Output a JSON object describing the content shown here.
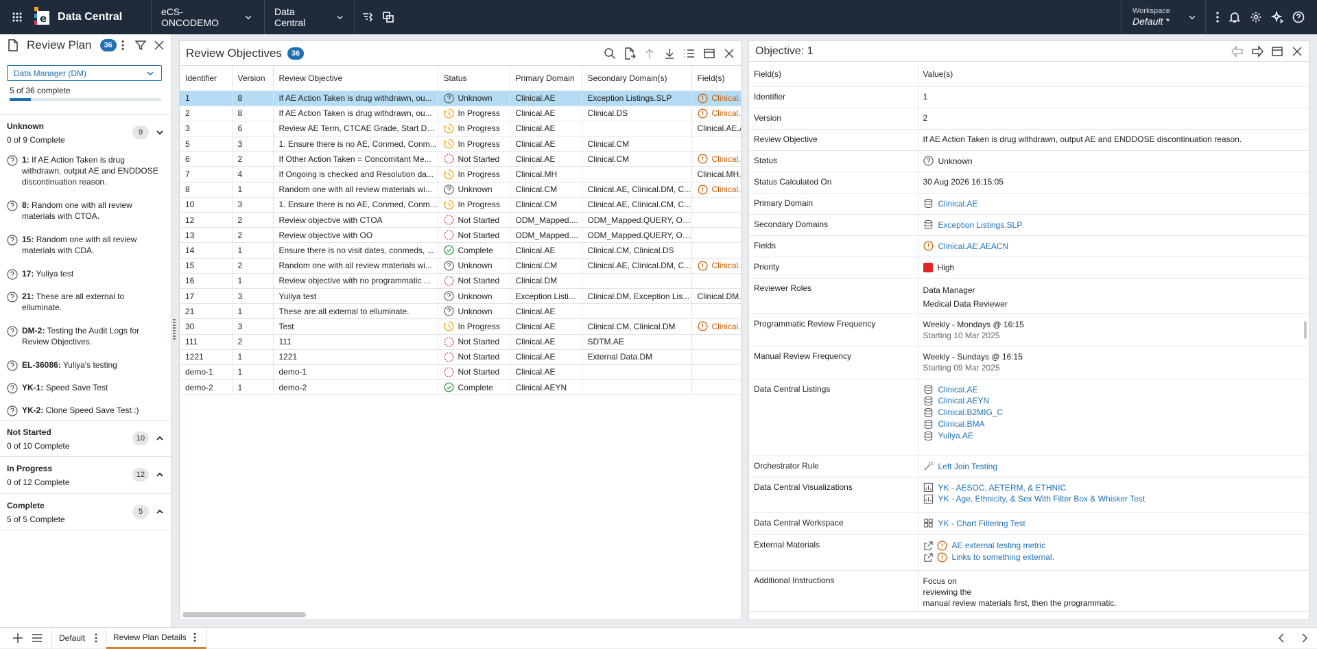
{
  "header": {
    "app_name": "Data Central",
    "study": "eCS-ONCODEMO",
    "module": "Data Central",
    "workspace_label": "Workspace",
    "workspace_value": "Default",
    "workspace_mark": "*"
  },
  "left": {
    "title": "Review Plan",
    "count": "36",
    "role": "Data Manager (DM)",
    "progress_text": "5 of 36 complete",
    "progress_fraction": 0.139,
    "groups": [
      {
        "title": "Unknown",
        "sub": "0 of 9 Complete",
        "count": "9"
      },
      {
        "title": "Not Started",
        "sub": "0 of 10 Complete",
        "count": "10"
      },
      {
        "title": "In Progress",
        "sub": "0 of 12 Complete",
        "count": "12"
      },
      {
        "title": "Complete",
        "sub": "5 of 5 Complete",
        "count": "5"
      }
    ],
    "items": [
      {
        "id": "1:",
        "text": "If AE Action Taken is drug withdrawn, output AE and ENDDOSE discontinuation reason."
      },
      {
        "id": "8:",
        "text": "Random one with all review materials with CTOA."
      },
      {
        "id": "15:",
        "text": "Random one with all review materials with CDA."
      },
      {
        "id": "17:",
        "text": "Yuliya test"
      },
      {
        "id": "21:",
        "text": "These are all external to elluminate."
      },
      {
        "id": "DM-2:",
        "text": "Testing the Audit Logs for Review Objectives."
      },
      {
        "id": "EL-36086:",
        "text": "Yuliya's testing"
      },
      {
        "id": "YK-1:",
        "text": "Speed Save Test"
      },
      {
        "id": "YK-2:",
        "text": "Clone Speed Save Test :)"
      }
    ]
  },
  "objectives": {
    "title": "Review Objectives",
    "count": "36",
    "columns": [
      "Identifier",
      "Version",
      "Review Objective",
      "Status",
      "Primary Domain",
      "Secondary Domain(s)",
      "Field(s)"
    ],
    "rows": [
      [
        "1",
        "8",
        "If AE Action Taken is drug withdrawn, ou...",
        "Unknown",
        "Clinical.AE",
        "Exception Listings.SLP",
        "Clinical.AE"
      ],
      [
        "2",
        "8",
        "If AE Action Taken is drug withdrawn, ou...",
        "In Progress",
        "Clinical.AE",
        "Clinical.DS",
        "Clinical.AE"
      ],
      [
        "3",
        "6",
        "Review AE Term, CTCAE Grade, Start Dat...",
        "In Progress",
        "Clinical.AE",
        "",
        "Clinical.AE.A"
      ],
      [
        "5",
        "3",
        "1. Ensure there is no AE, Conmed, Conm...",
        "In Progress",
        "Clinical.AE",
        "Clinical.CM",
        ""
      ],
      [
        "6",
        "2",
        "If Other Action Taken = Concomitant Me...",
        "Not Started",
        "Clinical.AE",
        "Clinical.CM",
        "Clinical.AE"
      ],
      [
        "7",
        "4",
        "If Ongoing is checked and Resolution da...",
        "In Progress",
        "Clinical.MH",
        "",
        "Clinical.MH."
      ],
      [
        "8",
        "1",
        "Random one with all review materials wi...",
        "Unknown",
        "Clinical.CM",
        "Clinical.AE, Clinical.DM, C...",
        "Clinical.AE"
      ],
      [
        "10",
        "3",
        "1. Ensure there is no AE, Conmed, Conm...",
        "In Progress",
        "Clinical.CM",
        "Clinical.AE, Clinical.CM, C...",
        ""
      ],
      [
        "12",
        "2",
        "Review objective with CTOA",
        "Not Started",
        "ODM_Mapped....",
        "ODM_Mapped.QUERY, OD...",
        ""
      ],
      [
        "13",
        "2",
        "Review objective with OO",
        "Not Started",
        "ODM_Mapped....",
        "ODM_Mapped.QUERY, OD...",
        ""
      ],
      [
        "14",
        "1",
        "Ensure there is no visit dates, conmeds, ...",
        "Complete",
        "Clinical.AE",
        "Clinical.CM, Clinical.DS",
        ""
      ],
      [
        "15",
        "2",
        "Random one with all review materials wi...",
        "Unknown",
        "Clinical.CM",
        "Clinical.AE, Clinical.DM, C...",
        "Clinical.AE"
      ],
      [
        "16",
        "1",
        "Review objective with no programmatic ...",
        "Not Started",
        "Clinical.DM",
        "",
        ""
      ],
      [
        "17",
        "3",
        "Yuliya test",
        "Unknown",
        "Exception Listi...",
        "Clinical.DM, Exception Lis...",
        "Clinical.DM."
      ],
      [
        "21",
        "1",
        "These are all external to elluminate.",
        "Unknown",
        "Clinical.AE",
        "",
        ""
      ],
      [
        "30",
        "3",
        "Test",
        "In Progress",
        "Clinical.AE",
        "Clinical.CM, Clinical.DM",
        "Clinical.AE"
      ],
      [
        "111",
        "2",
        "111",
        "Not Started",
        "Clinical.AE",
        "SDTM.AE",
        ""
      ],
      [
        "1221",
        "1",
        "1221",
        "Not Started",
        "Clinical.AE",
        "External Data.DM",
        ""
      ],
      [
        "demo-1",
        "1",
        "demo-1",
        "Not Started",
        "Clinical.AE",
        "",
        ""
      ],
      [
        "demo-2",
        "1",
        "demo-2",
        "Complete",
        "Clinical.AEYN",
        "",
        ""
      ]
    ]
  },
  "detail": {
    "title": "Objective: 1",
    "col1": "Field(s)",
    "col2": "Value(s)",
    "labels": {
      "identifier": "Identifier",
      "version": "Version",
      "objective": "Review Objective",
      "status": "Status",
      "calc": "Status Calculated On",
      "primary": "Primary Domain",
      "secondary": "Secondary Domains",
      "fields": "Fields",
      "priority": "Priority",
      "roles": "Reviewer Roles",
      "prog": "Programmatic Review Frequency",
      "manual": "Manual Review Frequency",
      "listings": "Data Central Listings",
      "orch": "Orchestrator Rule",
      "viz": "Data Central Visualizations",
      "workspace": "Data Central Workspace",
      "external": "External Materials",
      "instr": "Additional Instructions"
    },
    "values": {
      "identifier": "1",
      "version": "2",
      "objective": "If AE Action Taken is drug withdrawn, output AE and ENDDOSE discontinuation reason.",
      "status": "Unknown",
      "calc": "30 Aug 2026 16:15:05",
      "primary": "Clinical.AE",
      "secondary": "Exception Listings.SLP",
      "fields": "Clinical.AE.AEACN",
      "priority": "High",
      "roles": [
        "Data Manager",
        "Medical Data Reviewer"
      ],
      "prog": "Weekly - Mondays @ 16:15",
      "prog_sub": "Starting 10 Mar 2025",
      "manual": "Weekly - Sundays @ 16:15",
      "manual_sub": "Starting 09 Mar 2025",
      "listings": [
        "Clinical.AE",
        "Clinical.AEYN",
        "Clinical.B2MIG_C",
        "Clinical.BMA",
        "Yuliya.AE"
      ],
      "orch": "Left Join Testing",
      "viz": [
        "YK - AESOC, AETERM, & ETHNIC",
        "YK - Age, Ethnicity, & Sex With Filter Box & Whisker Test"
      ],
      "workspace": "YK - Chart Filtering Test",
      "external": [
        "AE external testing metric",
        "Links to something external."
      ],
      "instr": [
        "Focus on",
        "reviewing the",
        "manual review materials first, then the programmatic."
      ]
    },
    "colors": {
      "priority_high": "#e02424",
      "link": "#1f6fb5",
      "warning": "#c25a00"
    }
  },
  "bottom": {
    "tabs": [
      "Default",
      "Review Plan Details"
    ]
  }
}
